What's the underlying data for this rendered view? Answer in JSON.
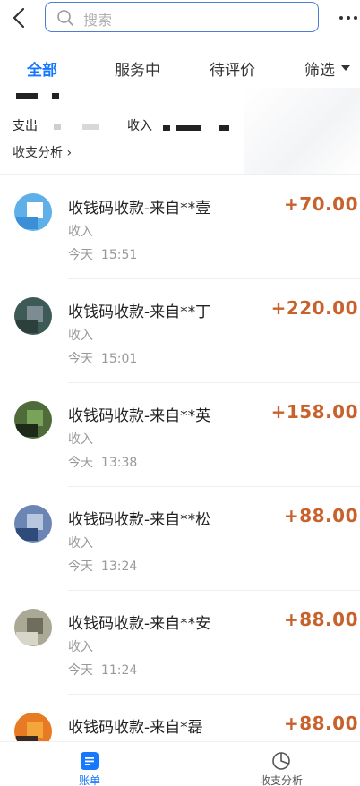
{
  "search": {
    "placeholder": "搜索"
  },
  "tabs": [
    {
      "label": "全部",
      "active": true
    },
    {
      "label": "服务中",
      "active": false
    },
    {
      "label": "待评价",
      "active": false
    },
    {
      "label": "筛选",
      "active": false
    }
  ],
  "summary": {
    "out_label": "支出",
    "in_label": "收入",
    "analysis_link": "收支分析 ›"
  },
  "transactions": [
    {
      "title": "收钱码收款-来自**壹",
      "kind": "收入",
      "day": "今天",
      "time": "15:51",
      "amount": "+70.00",
      "avatar_colors": [
        "#5fb0e8",
        "#ffffff",
        "#3a8fd6"
      ]
    },
    {
      "title": "收钱码收款-来自**丁",
      "kind": "收入",
      "day": "今天",
      "time": "15:01",
      "amount": "+220.00",
      "avatar_colors": [
        "#3e5a56",
        "#7d8c92",
        "#2c3f3b"
      ]
    },
    {
      "title": "收钱码收款-来自**英",
      "kind": "收入",
      "day": "今天",
      "time": "13:38",
      "amount": "+158.00",
      "avatar_colors": [
        "#4f6b3a",
        "#7aa35a",
        "#1d2a19"
      ]
    },
    {
      "title": "收钱码收款-来自**松",
      "kind": "收入",
      "day": "今天",
      "time": "13:24",
      "amount": "+88.00",
      "avatar_colors": [
        "#6b86b4",
        "#b9c7de",
        "#2f4b7a"
      ]
    },
    {
      "title": "收钱码收款-来自**安",
      "kind": "收入",
      "day": "今天",
      "time": "11:24",
      "amount": "+88.00",
      "avatar_colors": [
        "#a9a995",
        "#6f6e5e",
        "#d8d6c9"
      ]
    },
    {
      "title": "收钱码收款-来自*磊",
      "kind": "收入",
      "day": "",
      "time": "",
      "amount": "+88.00",
      "avatar_colors": [
        "#e87a23",
        "#f4a53c",
        "#3a2a22"
      ]
    }
  ],
  "bottom_nav": [
    {
      "label": "账单",
      "icon": "bill-icon",
      "active": true
    },
    {
      "label": "收支分析",
      "icon": "pie-chart-icon",
      "active": false
    }
  ],
  "colors": {
    "accent": "#1677ff",
    "amount": "#c8622d",
    "search_border": "#4a7fd0"
  }
}
